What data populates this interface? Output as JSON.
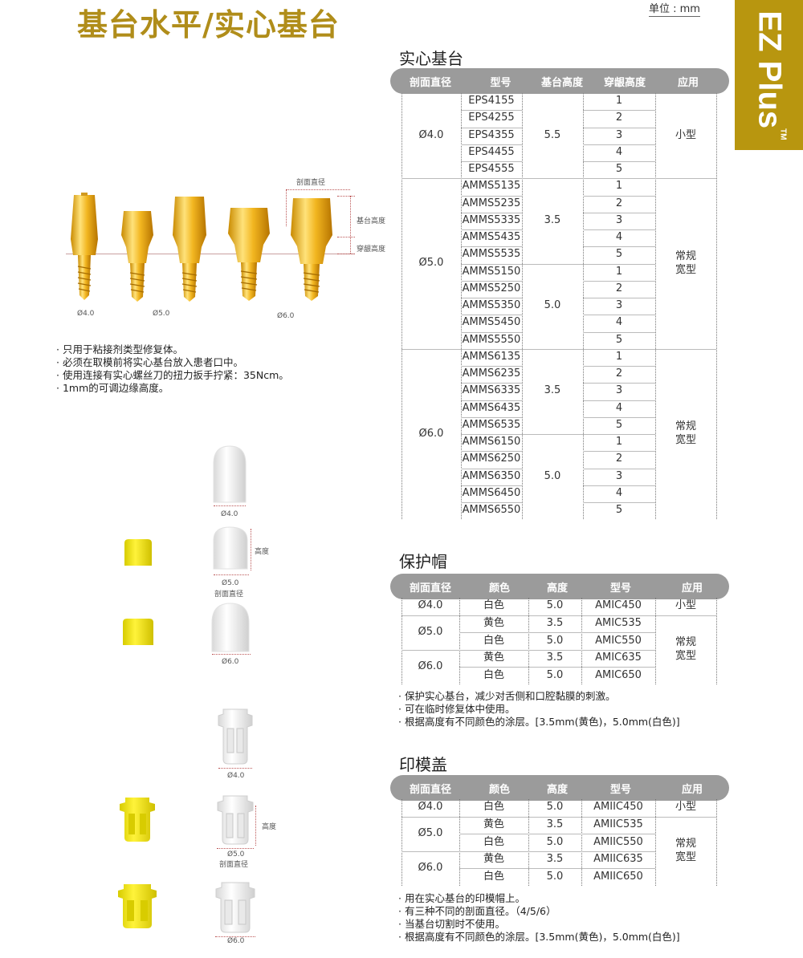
{
  "page": {
    "title": "基台水平/实心基台",
    "unit": "单位 : mm",
    "brand": "EZ Plus",
    "tm": "TM"
  },
  "diagram": {
    "labels": {
      "section_diameter": "剖面直径",
      "abutment_height": "基台高度",
      "cuff_height": "穿龈高度",
      "d40": "Ø4.0",
      "d50": "Ø5.0",
      "d60": "Ø6.0"
    }
  },
  "notes_main": [
    "只用于粘接剂类型修复体。",
    "必须在取模前将实心基台放入患者口中。",
    "使用连接有实心螺丝刀的扭力扳手拧紧：35Ncm。",
    "1mm的可调边缘高度。"
  ],
  "solid_abutment": {
    "title": "实心基台",
    "headers": [
      "剖面直径",
      "型号",
      "基台高度",
      "穿龈高度",
      "应用"
    ],
    "groups": [
      {
        "diameter": "Ø4.0",
        "application": "小型",
        "heights": [
          {
            "height": "5.5",
            "models": [
              "EPS4155",
              "EPS4255",
              "EPS4355",
              "EPS4455",
              "EPS4555"
            ]
          }
        ]
      },
      {
        "diameter": "Ø5.0",
        "application": "常规\n宽型",
        "heights": [
          {
            "height": "3.5",
            "models": [
              "AMMS5135",
              "AMMS5235",
              "AMMS5335",
              "AMMS5435",
              "AMMS5535"
            ]
          },
          {
            "height": "5.0",
            "models": [
              "AMMS5150",
              "AMMS5250",
              "AMMS5350",
              "AMMS5450",
              "AMMS5550"
            ]
          }
        ]
      },
      {
        "diameter": "Ø6.0",
        "application": "常规\n宽型",
        "heights": [
          {
            "height": "3.5",
            "models": [
              "AMMS6135",
              "AMMS6235",
              "AMMS6335",
              "AMMS6435",
              "AMMS6535"
            ]
          },
          {
            "height": "5.0",
            "models": [
              "AMMS6150",
              "AMMS6250",
              "AMMS6350",
              "AMMS6450",
              "AMMS6550"
            ]
          }
        ]
      }
    ],
    "cuffs": [
      "1",
      "2",
      "3",
      "4",
      "5"
    ]
  },
  "healing_cap": {
    "title": "保护帽",
    "headers": [
      "剖面直径",
      "颜色",
      "高度",
      "型号",
      "应用"
    ],
    "rows": [
      {
        "diameter": "Ø4.0",
        "items": [
          {
            "color": "白色",
            "height": "5.0",
            "model": "AMIC450"
          }
        ],
        "application": "小型"
      },
      {
        "diameter": "Ø5.0",
        "items": [
          {
            "color": "黄色",
            "height": "3.5",
            "model": "AMIC535"
          },
          {
            "color": "白色",
            "height": "5.0",
            "model": "AMIC550"
          }
        ],
        "application": ""
      },
      {
        "diameter": "Ø6.0",
        "items": [
          {
            "color": "黄色",
            "height": "3.5",
            "model": "AMIC635"
          },
          {
            "color": "白色",
            "height": "5.0",
            "model": "AMIC650"
          }
        ],
        "application": ""
      }
    ],
    "application_merged": "常规\n宽型",
    "notes": [
      "保护实心基台，减少对舌侧和口腔黏膜的刺激。",
      "可在临时修复体中使用。",
      "根据高度有不同颜色的涂层。[3.5mm(黄色)，5.0mm(白色)]"
    ],
    "fig_labels": {
      "d40": "Ø4.0",
      "d50": "Ø5.0",
      "section": "剖面直径",
      "height": "高度",
      "d60": "Ø6.0"
    }
  },
  "impression_cap": {
    "title": "印模盖",
    "headers": [
      "剖面直径",
      "颜色",
      "高度",
      "型号",
      "应用"
    ],
    "rows": [
      {
        "diameter": "Ø4.0",
        "items": [
          {
            "color": "白色",
            "height": "5.0",
            "model": "AMIIC450"
          }
        ],
        "application": "小型"
      },
      {
        "diameter": "Ø5.0",
        "items": [
          {
            "color": "黄色",
            "height": "3.5",
            "model": "AMIIC535"
          },
          {
            "color": "白色",
            "height": "5.0",
            "model": "AMIIC550"
          }
        ],
        "application": ""
      },
      {
        "diameter": "Ø6.0",
        "items": [
          {
            "color": "黄色",
            "height": "3.5",
            "model": "AMIIC635"
          },
          {
            "color": "白色",
            "height": "5.0",
            "model": "AMIIC650"
          }
        ],
        "application": ""
      }
    ],
    "application_merged": "常规\n宽型",
    "notes": [
      "用在实心基台的印模帽上。",
      "有三种不同的剖面直径。（4/5/6）",
      "当基台切割时不使用。",
      "根据高度有不同颜色的涂层。[3.5mm(黄色)，5.0mm(白色)]"
    ],
    "fig_labels": {
      "d40": "Ø4.0",
      "d50": "Ø5.0",
      "section": "剖面直径",
      "height": "高度",
      "d60": "Ø6.0"
    }
  },
  "colors": {
    "gold": "#b8960f",
    "header_gray": "#9b9b9b",
    "yellow": "#f2e600"
  }
}
